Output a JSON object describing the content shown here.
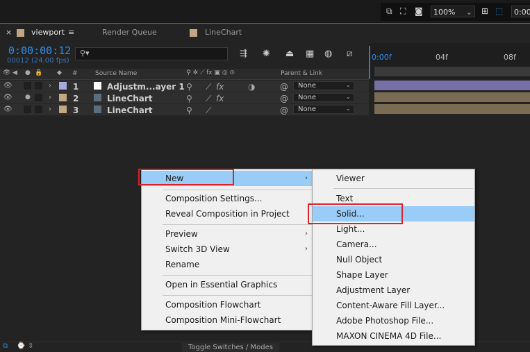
{
  "topbar": {
    "zoom": "100%",
    "timecode": "0:00"
  },
  "tabs": [
    {
      "label": "viewport",
      "color": "#c2a882"
    },
    {
      "label": "Render Queue"
    },
    {
      "label": "LineChart",
      "color": "#c2a882"
    }
  ],
  "timeline": {
    "timecode": "0:00:00:12",
    "frames": "00012 (24.00 fps)",
    "search_placeholder": "",
    "ruler": [
      "0:00f",
      "04f",
      "08f"
    ],
    "headers": {
      "num": "#",
      "source_name": "Source Name",
      "parent": "Parent & Link"
    },
    "layers": [
      {
        "num": "1",
        "name": "Adjustm...ayer 1",
        "parent": "None",
        "label_color": "#a9a9dc",
        "bar_color": "#7670a6",
        "fx": "fx"
      },
      {
        "num": "2",
        "name": "LineChart",
        "parent": "None",
        "label_color": "#c2a882",
        "bar_color": "#7a6c53",
        "fx": "fx"
      },
      {
        "num": "3",
        "name": "LineChart",
        "parent": "None",
        "label_color": "#c2a882",
        "bar_color": "#7a6c53",
        "fx": ""
      }
    ]
  },
  "context_menu": {
    "items": [
      "New",
      "Composition Settings...",
      "Reveal Composition in Project",
      "Preview",
      "Switch 3D View",
      "Rename",
      "Open in Essential Graphics",
      "Composition Flowchart",
      "Composition Mini-Flowchart"
    ]
  },
  "submenu": {
    "items": [
      "Viewer",
      "Text",
      "Solid...",
      "Light...",
      "Camera...",
      "Null Object",
      "Shape Layer",
      "Adjustment Layer",
      "Content-Aware Fill Layer...",
      "Adobe Photoshop File...",
      "MAXON CINEMA 4D File..."
    ]
  },
  "bottom": {
    "toggle": "Toggle Switches / Modes"
  },
  "colors": {
    "accent": "#2d7fc2",
    "highlight": "#99ccf7",
    "callout": "#e0212a"
  }
}
